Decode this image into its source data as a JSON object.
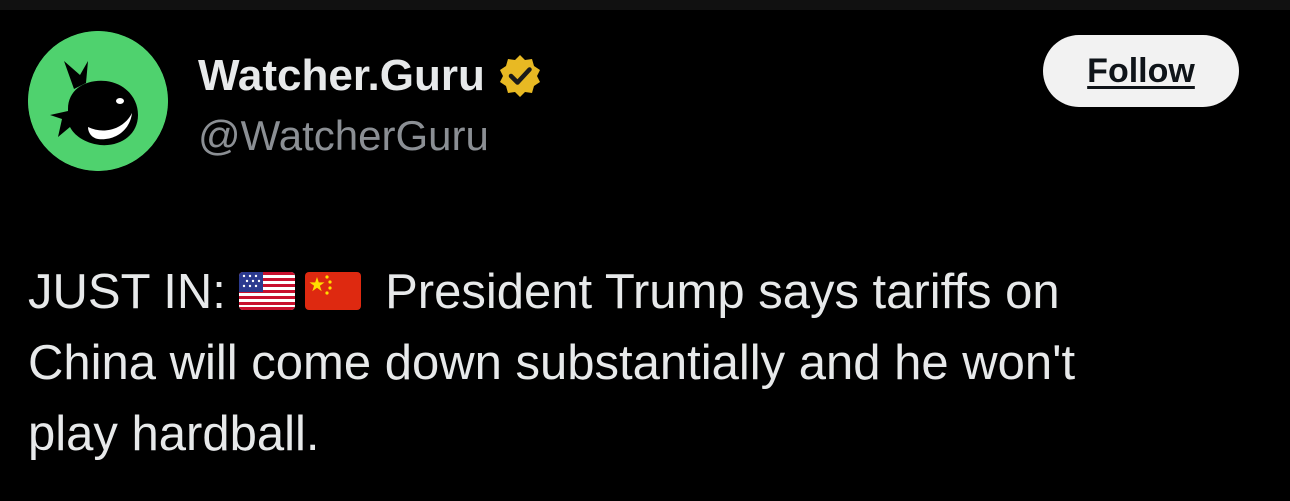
{
  "account": {
    "display_name": "Watcher.Guru",
    "handle": "@WatcherGuru",
    "verified_icon": "verified-badge-gold",
    "avatar_icon": "whale-logo",
    "avatar_color": "#4fd26e"
  },
  "actions": {
    "follow_label": "Follow"
  },
  "tweet": {
    "prefix": "JUST IN:",
    "flags": [
      "us-flag-emoji",
      "china-flag-emoji"
    ],
    "body_line_1": "President Trump says tariffs on",
    "body_line_2": "China will come down substantially and he won't",
    "body_line_3": "play hardball."
  },
  "colors": {
    "background": "#000000",
    "text": "#e7e9ea",
    "handle": "#8b8f94",
    "verified": "#e8b923"
  }
}
